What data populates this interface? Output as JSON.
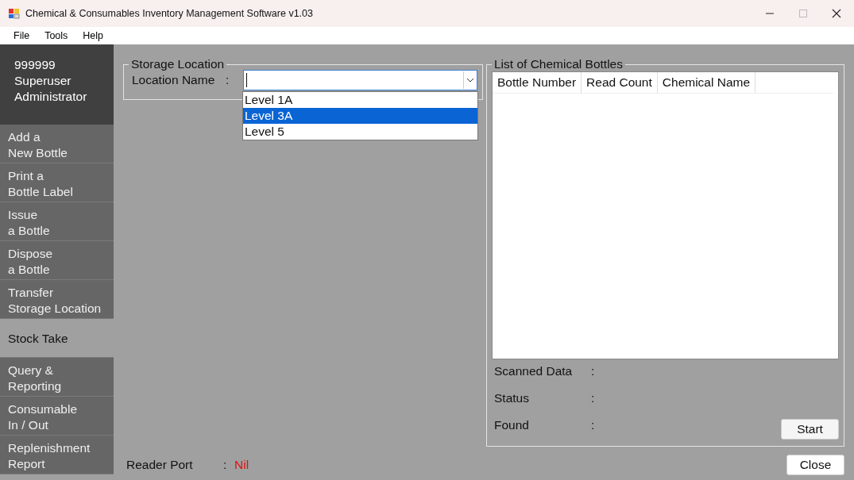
{
  "window": {
    "title": "Chemical & Consumables Inventory Management Software v1.03"
  },
  "menu": [
    "File",
    "Tools",
    "Help"
  ],
  "user": [
    "999999",
    "Superuser",
    "Administrator"
  ],
  "sidebar": {
    "items": [
      {
        "label": [
          "Add a",
          "New Bottle"
        ],
        "selected": false
      },
      {
        "label": [
          "Print a",
          "Bottle Label"
        ],
        "selected": false
      },
      {
        "label": [
          "Issue",
          "a Bottle"
        ],
        "selected": false
      },
      {
        "label": [
          "Dispose",
          "a Bottle"
        ],
        "selected": false
      },
      {
        "label": [
          "Transfer",
          "Storage Location"
        ],
        "selected": false
      },
      {
        "label": [
          "Stock Take"
        ],
        "selected": true
      },
      {
        "label": [
          "Query &",
          "Reporting"
        ],
        "selected": false
      },
      {
        "label": [
          "Consumable",
          "In / Out"
        ],
        "selected": false
      },
      {
        "label": [
          "Replenishment",
          "Report"
        ],
        "selected": false
      }
    ]
  },
  "storage_location": {
    "title": "Storage Location",
    "label": "Location Name",
    "colon": ":",
    "options": [
      {
        "label": "Level 1A",
        "selected": false
      },
      {
        "label": "Level 3A",
        "selected": true
      },
      {
        "label": "Level 5",
        "selected": false
      }
    ]
  },
  "reader_port": {
    "label": "Reader Port",
    "colon": ":",
    "value": "Nil"
  },
  "bottles": {
    "title": "List of Chemical Bottles",
    "columns": [
      "Bottle Number",
      "Read Count",
      "Chemical Name"
    ],
    "fields": [
      {
        "label": "Scanned Data",
        "colon": ":"
      },
      {
        "label": "Status",
        "colon": ":"
      },
      {
        "label": "Found",
        "colon": ":"
      }
    ],
    "start_button": "Start"
  },
  "close_button": "Close"
}
